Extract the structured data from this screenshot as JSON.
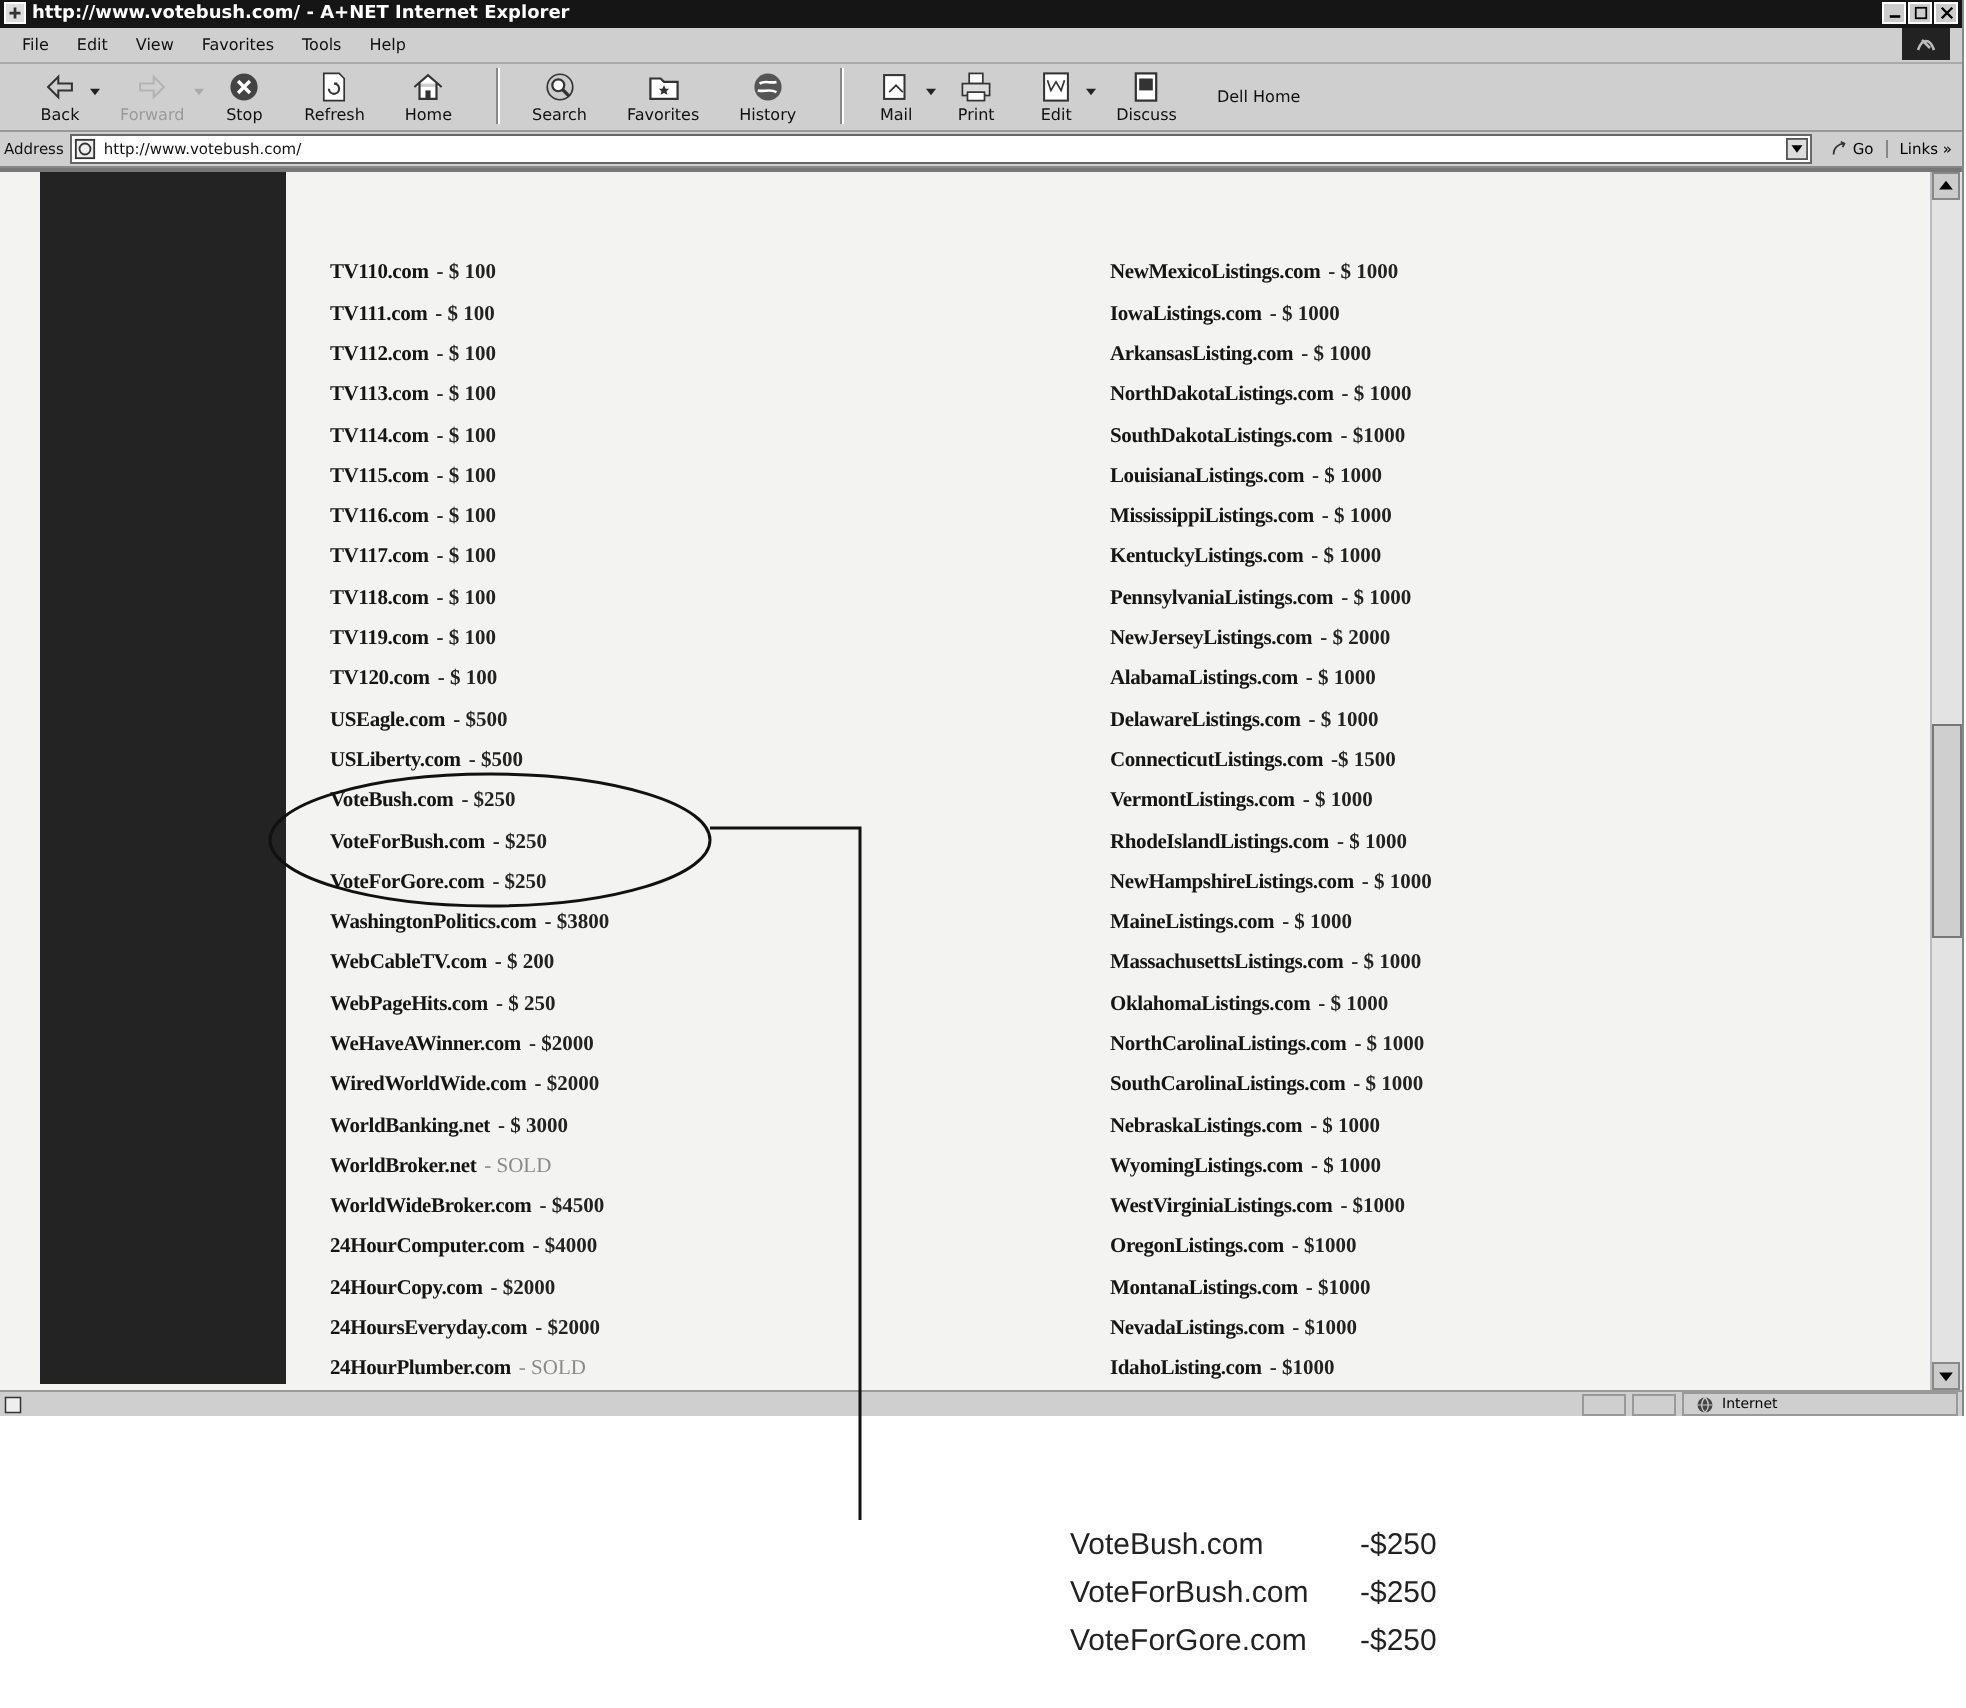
{
  "window": {
    "title": "http://www.votebush.com/ - A+NET Internet Explorer"
  },
  "menu": [
    "File",
    "Edit",
    "View",
    "Favorites",
    "Tools",
    "Help"
  ],
  "toolbar": [
    {
      "label": "Back",
      "kind": "back",
      "disabled": false,
      "dropdown": true
    },
    {
      "label": "Forward",
      "kind": "forward",
      "disabled": true,
      "dropdown": true
    },
    {
      "label": "Stop",
      "kind": "stop",
      "disabled": false,
      "dropdown": false
    },
    {
      "label": "Refresh",
      "kind": "refresh",
      "disabled": false,
      "dropdown": false
    },
    {
      "label": "Home",
      "kind": "home",
      "disabled": false,
      "dropdown": false
    },
    {
      "label": "Search",
      "kind": "search",
      "disabled": false,
      "dropdown": false
    },
    {
      "label": "Favorites",
      "kind": "favorites",
      "disabled": false,
      "dropdown": false
    },
    {
      "label": "History",
      "kind": "history",
      "disabled": false,
      "dropdown": false
    },
    {
      "label": "Mail",
      "kind": "mail",
      "disabled": false,
      "dropdown": true
    },
    {
      "label": "Print",
      "kind": "print",
      "disabled": false,
      "dropdown": false
    },
    {
      "label": "Edit",
      "kind": "edit",
      "disabled": false,
      "dropdown": true
    },
    {
      "label": "Discuss",
      "kind": "discuss",
      "disabled": false,
      "dropdown": false
    },
    {
      "label": "Dell Home",
      "kind": "text",
      "disabled": false,
      "dropdown": false
    }
  ],
  "address": {
    "label": "Address",
    "value": "http://www.votebush.com/",
    "go": "Go",
    "links": "Links »"
  },
  "listings_left": [
    {
      "name": "TV110.com",
      "price": "- $ 100",
      "sold": false
    },
    {
      "name": "TV111.com",
      "price": "- $ 100",
      "sold": false
    },
    {
      "name": "TV112.com",
      "price": "- $ 100",
      "sold": false
    },
    {
      "name": "TV113.com",
      "price": "- $ 100",
      "sold": false
    },
    {
      "name": "TV114.com",
      "price": "- $ 100",
      "sold": false
    },
    {
      "name": "TV115.com",
      "price": "- $ 100",
      "sold": false
    },
    {
      "name": "TV116.com",
      "price": "- $ 100",
      "sold": false
    },
    {
      "name": "TV117.com",
      "price": "- $ 100",
      "sold": false
    },
    {
      "name": "TV118.com",
      "price": "- $ 100",
      "sold": false
    },
    {
      "name": "TV119.com",
      "price": "- $ 100",
      "sold": false
    },
    {
      "name": "TV120.com",
      "price": "- $ 100",
      "sold": false
    },
    {
      "name": "USEagle.com",
      "price": "- $500",
      "sold": false
    },
    {
      "name": "USLiberty.com",
      "price": "- $500",
      "sold": false
    },
    {
      "name": "VoteBush.com",
      "price": "- $250",
      "sold": false
    },
    {
      "name": "VoteForBush.com",
      "price": "- $250",
      "sold": false
    },
    {
      "name": "VoteForGore.com",
      "price": "- $250",
      "sold": false
    },
    {
      "name": "WashingtonPolitics.com",
      "price": "- $3800",
      "sold": false
    },
    {
      "name": "WebCableTV.com",
      "price": "- $ 200",
      "sold": false
    },
    {
      "name": "WebPageHits.com",
      "price": "- $ 250",
      "sold": false
    },
    {
      "name": "WeHaveAWinner.com",
      "price": "- $2000",
      "sold": false
    },
    {
      "name": "WiredWorldWide.com",
      "price": "- $2000",
      "sold": false
    },
    {
      "name": "WorldBanking.net",
      "price": "- $ 3000",
      "sold": false
    },
    {
      "name": "WorldBroker.net",
      "price": "- SOLD",
      "sold": true
    },
    {
      "name": "WorldWideBroker.com",
      "price": "- $4500",
      "sold": false
    },
    {
      "name": "24HourComputer.com",
      "price": "- $4000",
      "sold": false
    },
    {
      "name": "24HourCopy.com",
      "price": "- $2000",
      "sold": false
    },
    {
      "name": "24HoursEveryday.com",
      "price": "- $2000",
      "sold": false
    },
    {
      "name": "24HourPlumber.com",
      "price": "- SOLD",
      "sold": true
    }
  ],
  "listings_right": [
    {
      "name": "NewMexicoListings.com",
      "price": "- $ 1000",
      "sold": false
    },
    {
      "name": "IowaListings.com",
      "price": "- $ 1000",
      "sold": false
    },
    {
      "name": "ArkansasListing.com",
      "price": "- $ 1000",
      "sold": false
    },
    {
      "name": "NorthDakotaListings.com",
      "price": "- $ 1000",
      "sold": false
    },
    {
      "name": "SouthDakotaListings.com",
      "price": "- $1000",
      "sold": false
    },
    {
      "name": "LouisianaListings.com",
      "price": "- $ 1000",
      "sold": false
    },
    {
      "name": "MississippiListings.com",
      "price": "- $ 1000",
      "sold": false
    },
    {
      "name": "KentuckyListings.com",
      "price": "- $ 1000",
      "sold": false
    },
    {
      "name": "PennsylvaniaListings.com",
      "price": "- $ 1000",
      "sold": false
    },
    {
      "name": "NewJerseyListings.com",
      "price": "- $ 2000",
      "sold": false
    },
    {
      "name": "AlabamaListings.com",
      "price": "- $ 1000",
      "sold": false
    },
    {
      "name": "DelawareListings.com",
      "price": "- $ 1000",
      "sold": false
    },
    {
      "name": "ConnecticutListings.com",
      "price": "-$ 1500",
      "sold": false
    },
    {
      "name": "VermontListings.com",
      "price": "- $ 1000",
      "sold": false
    },
    {
      "name": "RhodeIslandListings.com",
      "price": "- $ 1000",
      "sold": false
    },
    {
      "name": "NewHampshireListings.com",
      "price": "- $ 1000",
      "sold": false
    },
    {
      "name": "MaineListings.com",
      "price": "- $ 1000",
      "sold": false
    },
    {
      "name": "MassachusettsListings.com",
      "price": "- $ 1000",
      "sold": false
    },
    {
      "name": "OklahomaListings.com",
      "price": "- $ 1000",
      "sold": false
    },
    {
      "name": "NorthCarolinaListings.com",
      "price": "- $ 1000",
      "sold": false
    },
    {
      "name": "SouthCarolinaListings.com",
      "price": "- $ 1000",
      "sold": false
    },
    {
      "name": "NebraskaListings.com",
      "price": "- $ 1000",
      "sold": false
    },
    {
      "name": "WyomingListings.com",
      "price": "- $ 1000",
      "sold": false
    },
    {
      "name": "WestVirginiaListings.com",
      "price": "- $1000",
      "sold": false
    },
    {
      "name": "OregonListings.com",
      "price": "- $1000",
      "sold": false
    },
    {
      "name": "MontanaListings.com",
      "price": "- $1000",
      "sold": false
    },
    {
      "name": "NevadaListings.com",
      "price": "- $1000",
      "sold": false
    },
    {
      "name": "IdahoListing.com",
      "price": "- $1000",
      "sold": false
    }
  ],
  "status_bar": {
    "zone": "Internet"
  },
  "callout": [
    {
      "name": "VoteBush.com",
      "price": "-$250"
    },
    {
      "name": "VoteForBush.com",
      "price": "-$250"
    },
    {
      "name": "VoteForGore.com",
      "price": "-$250"
    }
  ]
}
